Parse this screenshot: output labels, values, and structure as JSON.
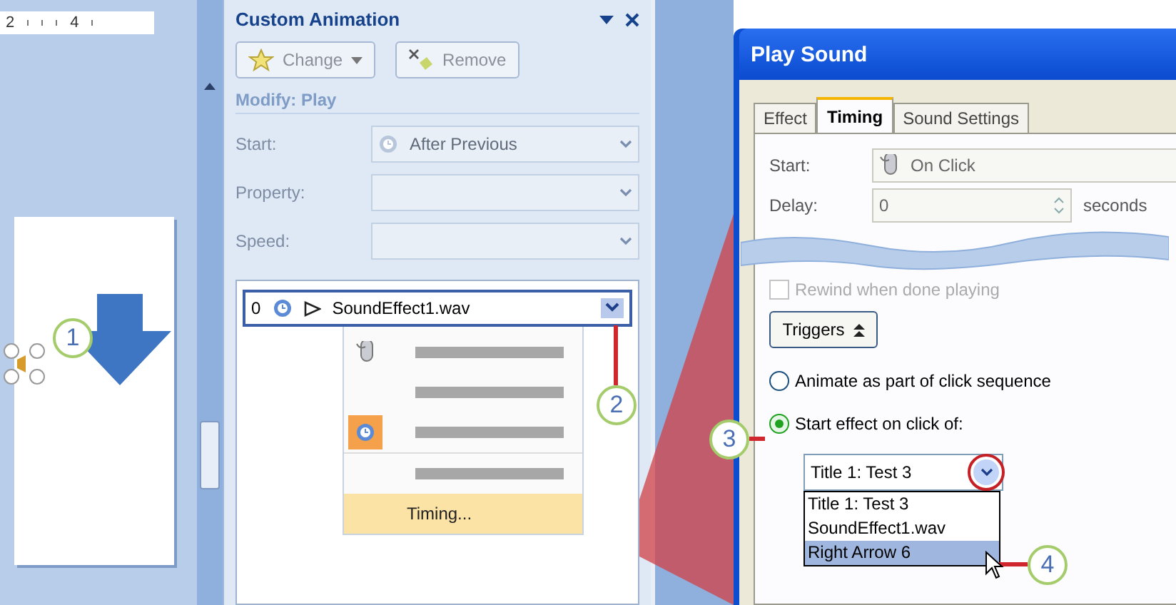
{
  "ruler": {
    "labels": [
      "2",
      "4"
    ]
  },
  "task_pane": {
    "title": "Custom Animation",
    "buttons": [
      {
        "label": "Change",
        "kind": "dropdown"
      },
      {
        "label": "Remove",
        "kind": "plain"
      }
    ],
    "section": "Modify: Play",
    "fields": [
      {
        "label": "Start:",
        "value": "After Previous",
        "kind": "clock"
      },
      {
        "label": "Property:",
        "kind": "empty"
      },
      {
        "label": "Speed:",
        "kind": "empty"
      }
    ],
    "list_item": {
      "order": "0",
      "name": "SoundEffect1.wav",
      "selected": true
    },
    "menu": [
      {
        "kind": "mouse",
        "checked": false,
        "selected": false
      },
      {
        "kind": "bar",
        "checked": false,
        "selected": false
      },
      {
        "kind": "clock",
        "checked": true,
        "selected": false
      },
      {
        "kind": "bar",
        "checked": false,
        "selected": false
      },
      {
        "kind": "text",
        "label": "Timing...",
        "checked": false,
        "selected": true
      }
    ]
  },
  "dialog": {
    "title": "Play Sound",
    "tabs": [
      {
        "label": "Effect",
        "selected": false
      },
      {
        "label": "Timing",
        "selected": true
      },
      {
        "label": "Sound Settings",
        "selected": false
      }
    ],
    "start": {
      "label": "Start:",
      "value": "On Click"
    },
    "delay": {
      "label": "Delay:",
      "value": "0",
      "unit": "seconds"
    },
    "rewind": {
      "label": "Rewind when done playing",
      "checked": false,
      "disabled": true
    },
    "triggers_button": "Triggers",
    "radios": [
      {
        "label": "Animate as part of click sequence",
        "selected": false
      },
      {
        "label": "Start effect on click of:",
        "selected": true
      }
    ],
    "trigger_combo": {
      "value": "Title 1: Test 3"
    },
    "trigger_options": [
      {
        "label": "Title 1: Test 3",
        "selected": false
      },
      {
        "label": "SoundEffect1.wav",
        "selected": false
      },
      {
        "label": "Right Arrow 6",
        "selected": true
      }
    ]
  },
  "callouts": [
    "1",
    "2",
    "3",
    "4"
  ]
}
